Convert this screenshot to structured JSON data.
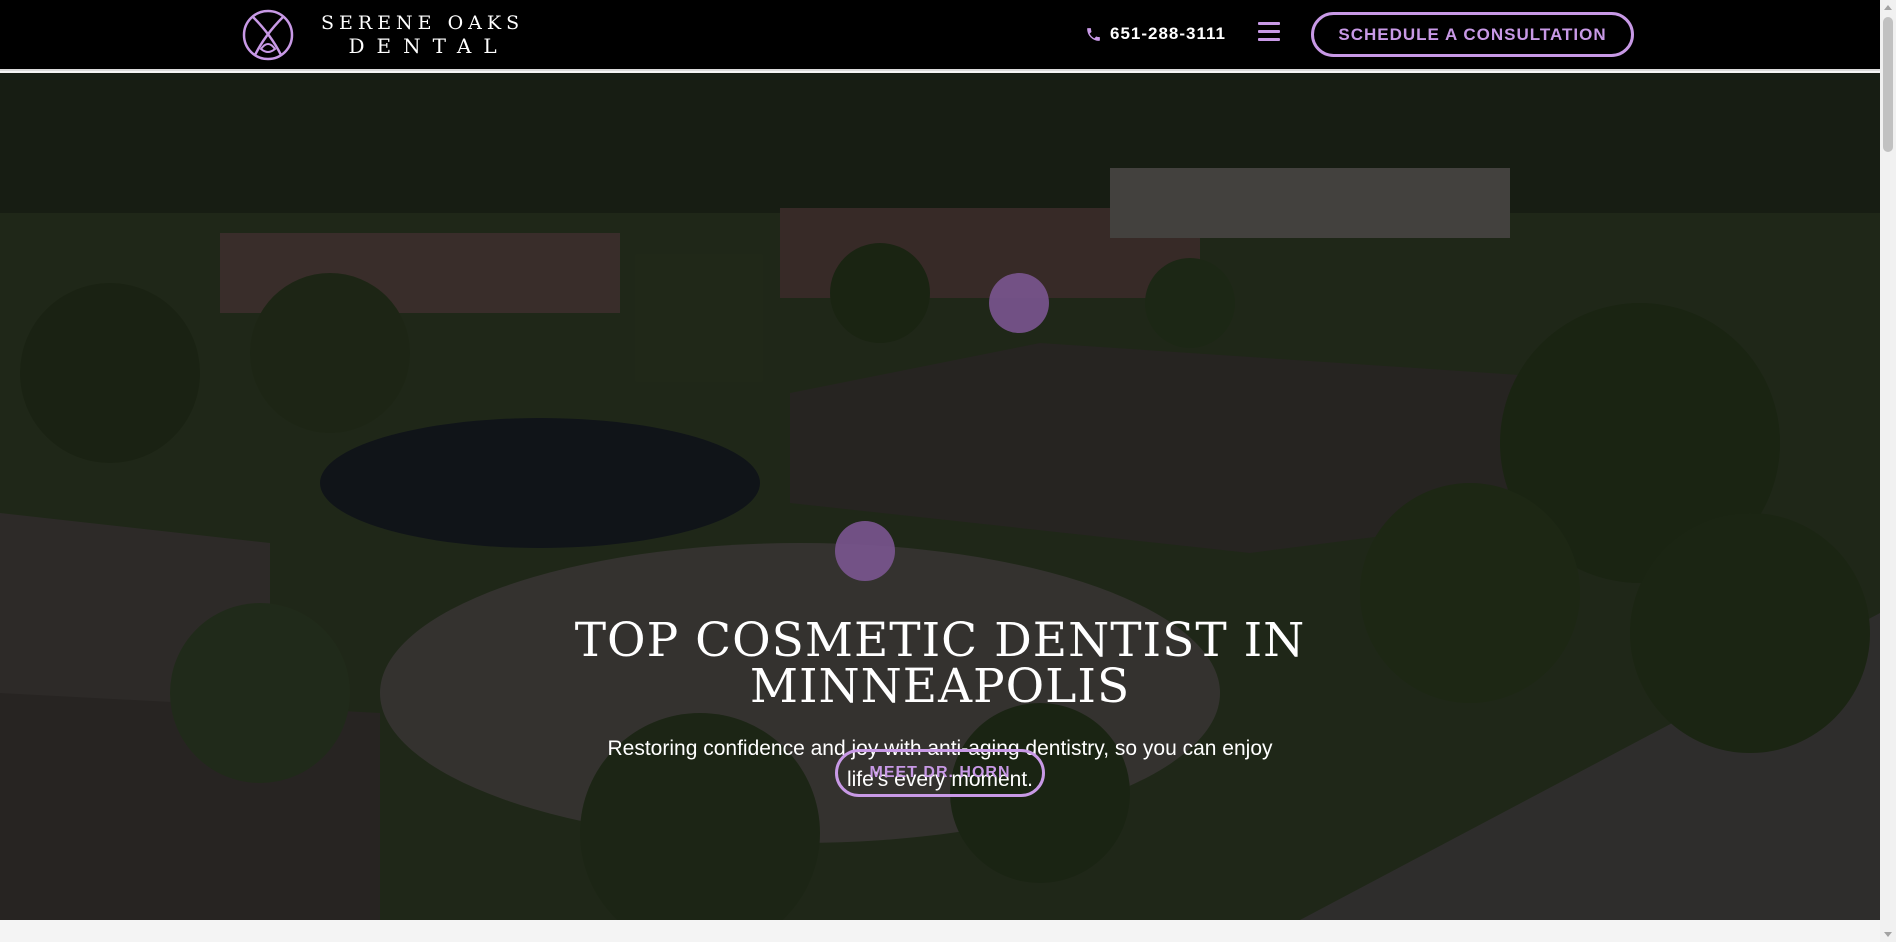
{
  "header": {
    "logo": {
      "line1": "SERENE OAKS",
      "line2": "DENTAL"
    },
    "phone": "651-288-3111",
    "cta_label": "SCHEDULE A CONSULTATION"
  },
  "hero": {
    "title_line1": "TOP COSMETIC DENTIST IN",
    "title_line2": "MINNEAPOLIS",
    "subtitle_line1": "Restoring confidence and joy with anti-aging dentistry, so you can enjoy",
    "subtitle_line2": "life's every moment.",
    "button_label": "MEET DR. HORN"
  },
  "icons": {
    "logo": "logo-mark-icon",
    "phone": "phone-icon",
    "menu": "hamburger-menu-icon"
  },
  "colors": {
    "accent": "#c899e6",
    "header_bg": "#000000",
    "dot": "#7a5590"
  }
}
